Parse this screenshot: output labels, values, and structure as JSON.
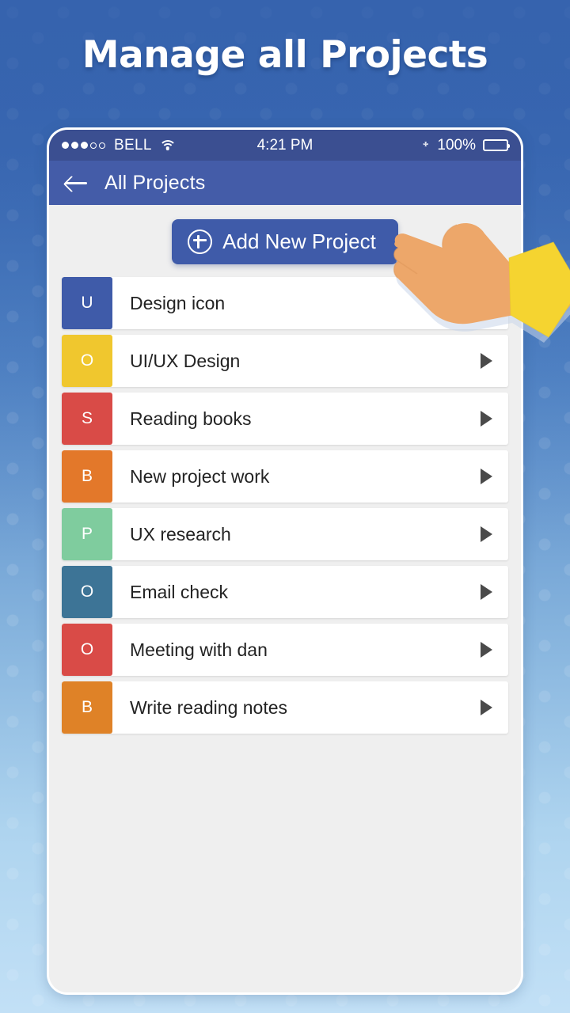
{
  "headline": "Manage all Projects",
  "colors": {
    "bg_top": "#3563ae",
    "bg_bottom": "#c2e0f6",
    "statusbar": "#3b4f91",
    "navbar": "#445ca8",
    "accent": "#3f5ba9",
    "content_bg": "#efefef",
    "row_bg": "#ffffff",
    "play_icon": "#4a4a4a",
    "hand_skin": "#eda76a",
    "hand_sleeve": "#f5d430"
  },
  "statusbar": {
    "signal_total": 5,
    "signal_filled": 3,
    "carrier": "BELL",
    "wifi_icon": "wifi-icon",
    "time": "4:21 PM",
    "bluetooth_icon": "bluetooth-icon",
    "battery_percent": "100%",
    "battery_level": 100
  },
  "navbar": {
    "back_icon": "back-arrow-icon",
    "title": "All Projects"
  },
  "toolbar": {
    "add_label": "Add New Project",
    "add_icon": "plus-circle-icon"
  },
  "list": {
    "items": [
      {
        "initial": "U",
        "color": "#3f5ba9",
        "label": "Design icon",
        "has_play": false
      },
      {
        "initial": "O",
        "color": "#f0c72e",
        "label": "UI/UX Design",
        "has_play": true
      },
      {
        "initial": "S",
        "color": "#d94b47",
        "label": "Reading books",
        "has_play": true
      },
      {
        "initial": "B",
        "color": "#e3782a",
        "label": "New project work",
        "has_play": true
      },
      {
        "initial": "P",
        "color": "#7fcc9e",
        "label": "UX research",
        "has_play": true
      },
      {
        "initial": "O",
        "color": "#3d7496",
        "label": "Email check",
        "has_play": true
      },
      {
        "initial": "O",
        "color": "#d94b47",
        "label": "Meeting with dan",
        "has_play": true
      },
      {
        "initial": "B",
        "color": "#df8227",
        "label": "Write reading notes",
        "has_play": true
      }
    ]
  },
  "overlay": {
    "hand_icon": "pointing-hand-icon"
  }
}
